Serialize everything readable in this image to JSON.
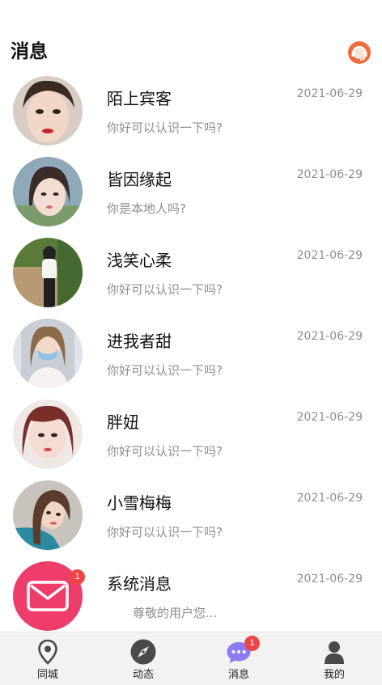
{
  "header": {
    "title": "消息",
    "support_icon": "customer-service-icon"
  },
  "conversations": [
    {
      "name": "陌上宾客",
      "message": "你好可以认识一下吗?",
      "date": "2021-06-29"
    },
    {
      "name": "皆因缘起",
      "message": "你是本地人吗?",
      "date": "2021-06-29"
    },
    {
      "name": "浅笑心柔",
      "message": "你好可以认识一下吗?",
      "date": "2021-06-29"
    },
    {
      "name": "进我者甜",
      "message": "你好可以认识一下吗?",
      "date": "2021-06-29"
    },
    {
      "name": "胖妞",
      "message": "你好可以认识一下吗?",
      "date": "2021-06-29"
    },
    {
      "name": "小雪梅梅",
      "message": "你好可以认识一下吗?",
      "date": "2021-06-29"
    }
  ],
  "system": {
    "name": "系统消息",
    "message": "尊敬的用户您...",
    "date": "2021-06-29",
    "badge": "1",
    "icon": "envelope-icon"
  },
  "tabs": [
    {
      "label": "同城",
      "icon": "location-pin-icon"
    },
    {
      "label": "动态",
      "icon": "compass-icon"
    },
    {
      "label": "消息",
      "icon": "chat-bubble-icon",
      "badge": "1",
      "active": true
    },
    {
      "label": "我的",
      "icon": "user-icon"
    }
  ],
  "colors": {
    "accent": "#ee3d6b",
    "badge": "#ef4444",
    "chat_active": "#8b7cf6",
    "support": "#f26b3a"
  }
}
